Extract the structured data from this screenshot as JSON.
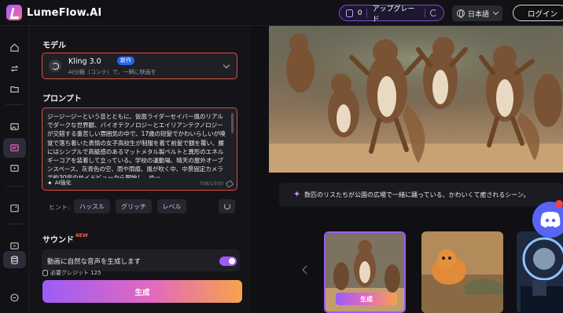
{
  "app": {
    "name": "LumeFlow.AI"
  },
  "header": {
    "credits": "0",
    "upgrade_label": "アップグレード",
    "language": "日本語",
    "login_label": "ログイン"
  },
  "panel": {
    "model_title": "モデル",
    "model": {
      "name": "Kling 3.0",
      "badge": "新作",
      "description": "AI分鏡（コンテ）で、一瞬に映画を"
    },
    "prompt_title": "プロンプト",
    "prompt_text": "ジージージーという音とともに、仮面ライダーセイバー風のリアルでダークな世界観、バイオテクノロジーとエイリアンテクノロジーが交錯する重苦しい雰囲気の中で、17歳の短髪でかわいらしいが嗅覚で落ち着いた表情の女子高校生が制服を着て前髪で額を覆い、腰にはシンプルで高級感のあるマットメタル製ベルトと異形のエネルギーコアを装着して立っている。学校の運動場、晴天の屋外オープンスペース、灰青色の空、雨や雨痕、風が吹く中、中景固定カメラで約30度のサイドビューから開始し、ゆっ",
    "ai_enhance_label": "AI強化",
    "char_count": "708/1500",
    "hint_label": "ヒント:",
    "hints": [
      "ハッスル",
      "グリッチ",
      "レベル"
    ],
    "sound_title": "サウンド",
    "sound_new": "NEW",
    "sound_option": "動画に自然な音声を生成します",
    "sound_enabled": true,
    "credits_needed": "必要クレジット 125",
    "generate_label": "生成"
  },
  "preview": {
    "caption": "数匹のリスたちが公園の広場で一緒に踊っている、かわいくて癒されるシーン。",
    "thumbnail_generate_label": "生成"
  },
  "colors": {
    "accent": "#9b5cf6",
    "highlight_border": "#e0503c",
    "discord": "#5865f2"
  }
}
